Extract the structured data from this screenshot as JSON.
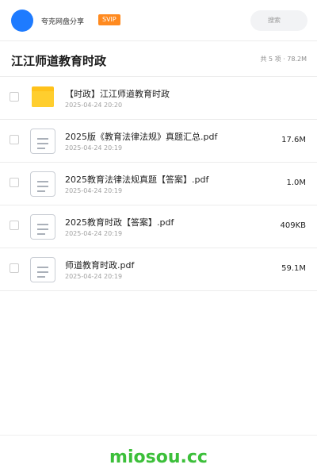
{
  "header": {
    "app_name": "夸克网盘分享",
    "badge": "SVIP",
    "search_placeholder": "搜索"
  },
  "folder": {
    "title": "江江师道教育时政",
    "summary": "共 5 项 · 78.2M"
  },
  "files": [
    {
      "type": "folder",
      "name": "【时政】江江师道教育时政",
      "date": "2025-04-24 20:20",
      "size": ""
    },
    {
      "type": "file",
      "name": "2025版《教育法律法规》真题汇总.pdf",
      "date": "2025-04-24 20:19",
      "size": "17.6M"
    },
    {
      "type": "file",
      "name": "2025教育法律法规真题【答案】.pdf",
      "date": "2025-04-24 20:19",
      "size": "1.0M"
    },
    {
      "type": "file",
      "name": "2025教育时政【答案】.pdf",
      "date": "2025-04-24 20:19",
      "size": "409KB"
    },
    {
      "type": "file",
      "name": "师道教育时政.pdf",
      "date": "2025-04-24 20:19",
      "size": "59.1M"
    }
  ],
  "footer": {
    "brand": "miosou.cc"
  },
  "colors": {
    "accent": "#1e7bff",
    "svip": "#ff8a1f",
    "folder": "#ffc21a",
    "brand": "#3cbf3a"
  },
  "icons": {
    "avatar": "avatar-circle",
    "folder": "folder-icon",
    "file": "document-icon"
  }
}
